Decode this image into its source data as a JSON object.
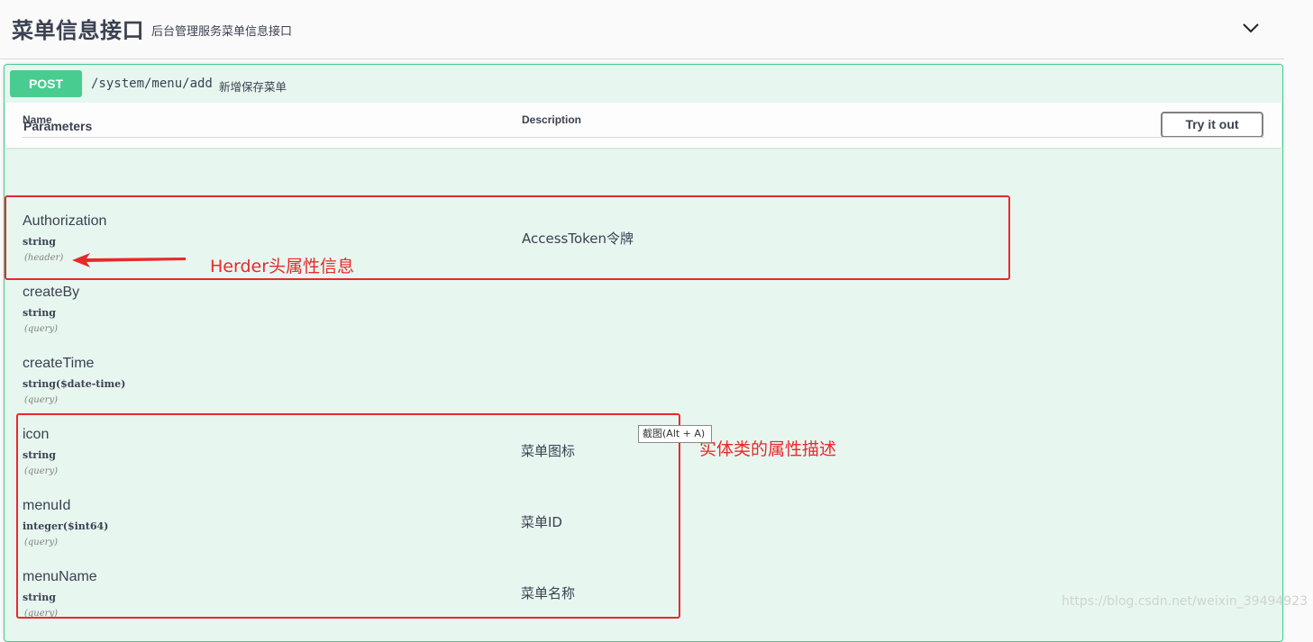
{
  "tag": {
    "title": "菜单信息接口",
    "description": "后台管理服务菜单信息接口"
  },
  "operation": {
    "method": "POST",
    "path": "/system/menu/add",
    "summary": "新增保存菜单"
  },
  "parameters_section": {
    "title": "Parameters",
    "try_button": "Try it out",
    "col_name": "Name",
    "col_description": "Description"
  },
  "params": [
    {
      "name": "Authorization",
      "type": "string",
      "in": "(header)",
      "description": "AccessToken令牌"
    },
    {
      "name": "createBy",
      "type": "string",
      "in": "(query)",
      "description": ""
    },
    {
      "name": "createTime",
      "type": "string($date-time)",
      "in": "(query)",
      "description": ""
    },
    {
      "name": "icon",
      "type": "string",
      "in": "(query)",
      "description": "菜单图标"
    },
    {
      "name": "menuId",
      "type": "integer($int64)",
      "in": "(query)",
      "description": "菜单ID"
    },
    {
      "name": "menuName",
      "type": "string",
      "in": "(query)",
      "description": "菜单名称"
    }
  ],
  "annotations": {
    "header_note": "Herder头属性信息",
    "entity_note": "实体类的属性描述",
    "tooltip": "截图(Alt + A)"
  },
  "watermark": "https://blog.csdn.net/weixin_39494923",
  "colors": {
    "post_green": "#49cc90",
    "annotation_red": "#e8292b"
  }
}
